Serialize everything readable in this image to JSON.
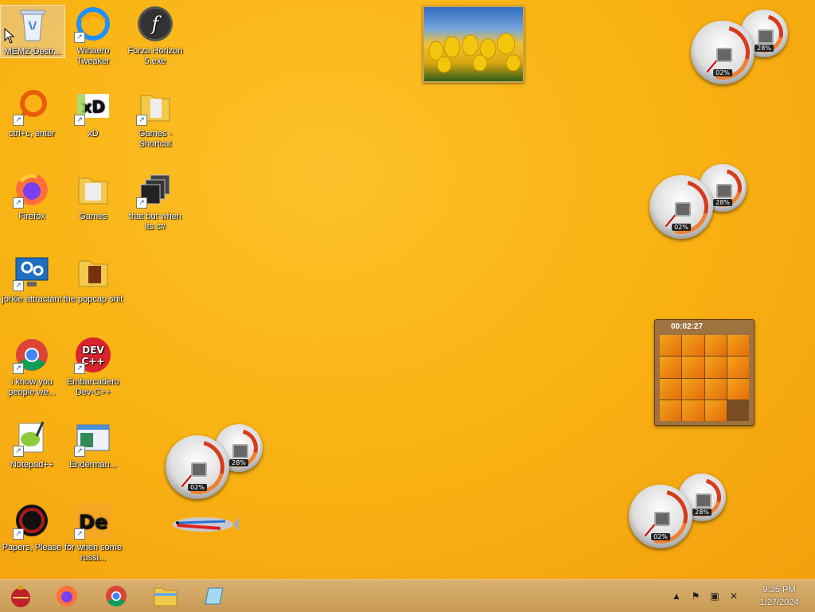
{
  "desktop": {
    "icons": [
      {
        "label": "MEMZ-Destr...",
        "icon": "recycle-bin-icon",
        "selected": true
      },
      {
        "label": "Winaero Tweaker",
        "icon": "winaero-tweaker-icon"
      },
      {
        "label": "Forza Horizon 5.exe",
        "icon": "flash-icon"
      },
      {
        "label": "ctrl+c, enter",
        "icon": "ring-icon"
      },
      {
        "label": "xD",
        "icon": "hxd-icon"
      },
      {
        "label": "Games - Shortcut",
        "icon": "folder-icon"
      },
      {
        "label": "Firefox",
        "icon": "firefox-icon"
      },
      {
        "label": "Games",
        "icon": "folder-icon"
      },
      {
        "label": "that but when its c#",
        "icon": "stacked-windows-icon"
      },
      {
        "label": "jorkie attractant",
        "icon": "settings-monitor-icon"
      },
      {
        "label": "the popcap shit",
        "icon": "folder-icon"
      },
      {
        "label": "i know you people we...",
        "icon": "chrome-icon"
      },
      {
        "label": "Embarcadero Dev-C++",
        "icon": "devcpp-icon"
      },
      {
        "label": "Notepad++",
        "icon": "notepadpp-icon"
      },
      {
        "label": "Enderman...",
        "icon": "app-window-icon"
      },
      {
        "label": "Papers, Please",
        "icon": "papers-please-icon"
      },
      {
        "label": "for when some russi...",
        "icon": "de-icon"
      }
    ]
  },
  "gadgets": {
    "meters": [
      {
        "cpu": "02%",
        "mem": "28%"
      },
      {
        "cpu": "02%",
        "mem": "28%"
      },
      {
        "cpu": "02%",
        "mem": "28%"
      },
      {
        "cpu": "02%",
        "mem": "28%"
      }
    ],
    "puzzle": {
      "timer": "00:02:27"
    },
    "slideshow": {
      "subject": "yellow tulips"
    }
  },
  "taskbar": {
    "pinned": [
      "start-ornament-icon",
      "firefox-icon",
      "chrome-icon",
      "file-explorer-icon",
      "notepad-icon"
    ],
    "clock": {
      "time": "9:35 PM",
      "date": "1/27/2024"
    }
  },
  "colors": {
    "desktop": "#f9b414",
    "taskbar": "#d0a560",
    "accent": "#e36c0a"
  }
}
